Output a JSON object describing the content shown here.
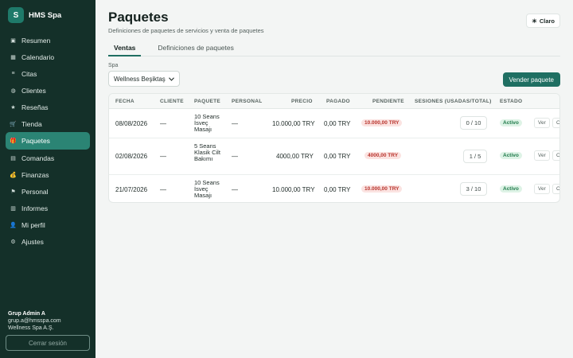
{
  "brand": {
    "logo_letter": "S",
    "name": "HMS Spa"
  },
  "nav": [
    {
      "label": "Resumen",
      "icon": "▣"
    },
    {
      "label": "Calendario",
      "icon": "▦"
    },
    {
      "label": "Citas",
      "icon": "≡"
    },
    {
      "label": "Clientes",
      "icon": "◍"
    },
    {
      "label": "Reseñas",
      "icon": "★"
    },
    {
      "label": "Tienda",
      "icon": "🛒"
    },
    {
      "label": "Paquetes",
      "icon": "🎁"
    },
    {
      "label": "Comandas",
      "icon": "▤"
    },
    {
      "label": "Finanzas",
      "icon": "💰"
    },
    {
      "label": "Personal",
      "icon": "⚑"
    },
    {
      "label": "Informes",
      "icon": "▥"
    },
    {
      "label": "Mi perfil",
      "icon": "👤"
    },
    {
      "label": "Ajustes",
      "icon": "⚙"
    }
  ],
  "user": {
    "name": "Grup Admin A",
    "email": "grup.a@hmsspa.com",
    "org": "Wellness Spa A.Ş."
  },
  "logout_label": "Cerrar sesión",
  "page": {
    "title": "Paquetes",
    "subtitle": "Definiciones de paquetes de servicios y venta de paquetes",
    "theme_icon": "☀",
    "theme_label": "Claro",
    "tabs": [
      "Ventas",
      "Definiciones de paquetes"
    ],
    "spa_label": "Spa",
    "spa_value": "Wellness Beşiktaş",
    "sell_label": "Vender paquete"
  },
  "table": {
    "headers": [
      "FECHA",
      "CLIENTE",
      "PAQUETE",
      "PERSONAL",
      "PRECIO",
      "PAGADO",
      "PENDIENTE",
      "SESIONES (USADAS/TOTAL)",
      "ESTADO"
    ],
    "rows": [
      {
        "fecha": "08/08/2026",
        "cliente": "—",
        "paquete": "10 Seans İsveç Masajı",
        "personal": "—",
        "precio": "10.000,00 TRY",
        "pagado": "0,00 TRY",
        "pendiente": "10.000,00 TRY",
        "sesiones": "0 / 10",
        "estado": "Activo",
        "ver": "Ver",
        "more": "Co"
      },
      {
        "fecha": "02/08/2026",
        "cliente": "—",
        "paquete": "5 Seans Klasik Cilt Bakımı",
        "personal": "—",
        "precio": "4000,00 TRY",
        "pagado": "0,00 TRY",
        "pendiente": "4000,00 TRY",
        "sesiones": "1 / 5",
        "estado": "Activo",
        "ver": "Ver",
        "more": "Co"
      },
      {
        "fecha": "21/07/2026",
        "cliente": "—",
        "paquete": "10 Seans İsveç Masajı",
        "personal": "—",
        "precio": "10.000,00 TRY",
        "pagado": "0,00 TRY",
        "pendiente": "10.000,00 TRY",
        "sesiones": "3 / 10",
        "estado": "Activo",
        "ver": "Ver",
        "more": "Co"
      }
    ]
  }
}
